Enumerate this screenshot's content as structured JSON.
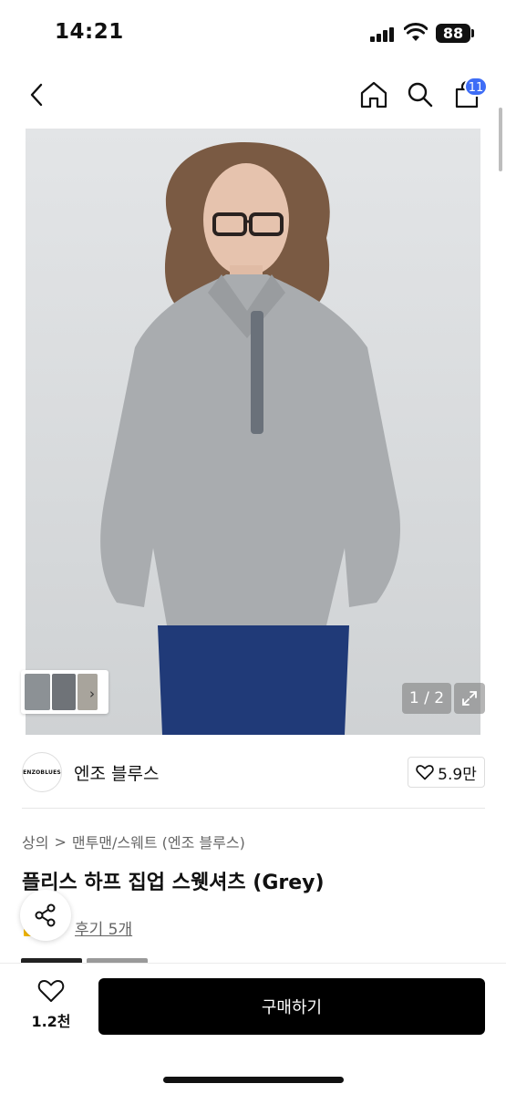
{
  "status_bar": {
    "time": "14:21",
    "battery": "88"
  },
  "nav": {
    "cart_count": "11"
  },
  "product": {
    "image_counter": "1 / 2",
    "brand": {
      "logo_text": "ENZOBLUES",
      "name": "엔조 블루스",
      "likes": "5.9만"
    },
    "breadcrumb": [
      "상의",
      "맨투맨/스웨트 (엔조 블루스)"
    ],
    "breadcrumb_separator": ">",
    "title": "플리스 하프 집업 스웻셔츠 (Grey)",
    "review_link": "후기 5개"
  },
  "bottom_bar": {
    "wish_count": "1.2천",
    "buy_label": "구매하기"
  },
  "colors": {
    "accent_badge": "#3e6df6",
    "buy_button": "#000000"
  }
}
